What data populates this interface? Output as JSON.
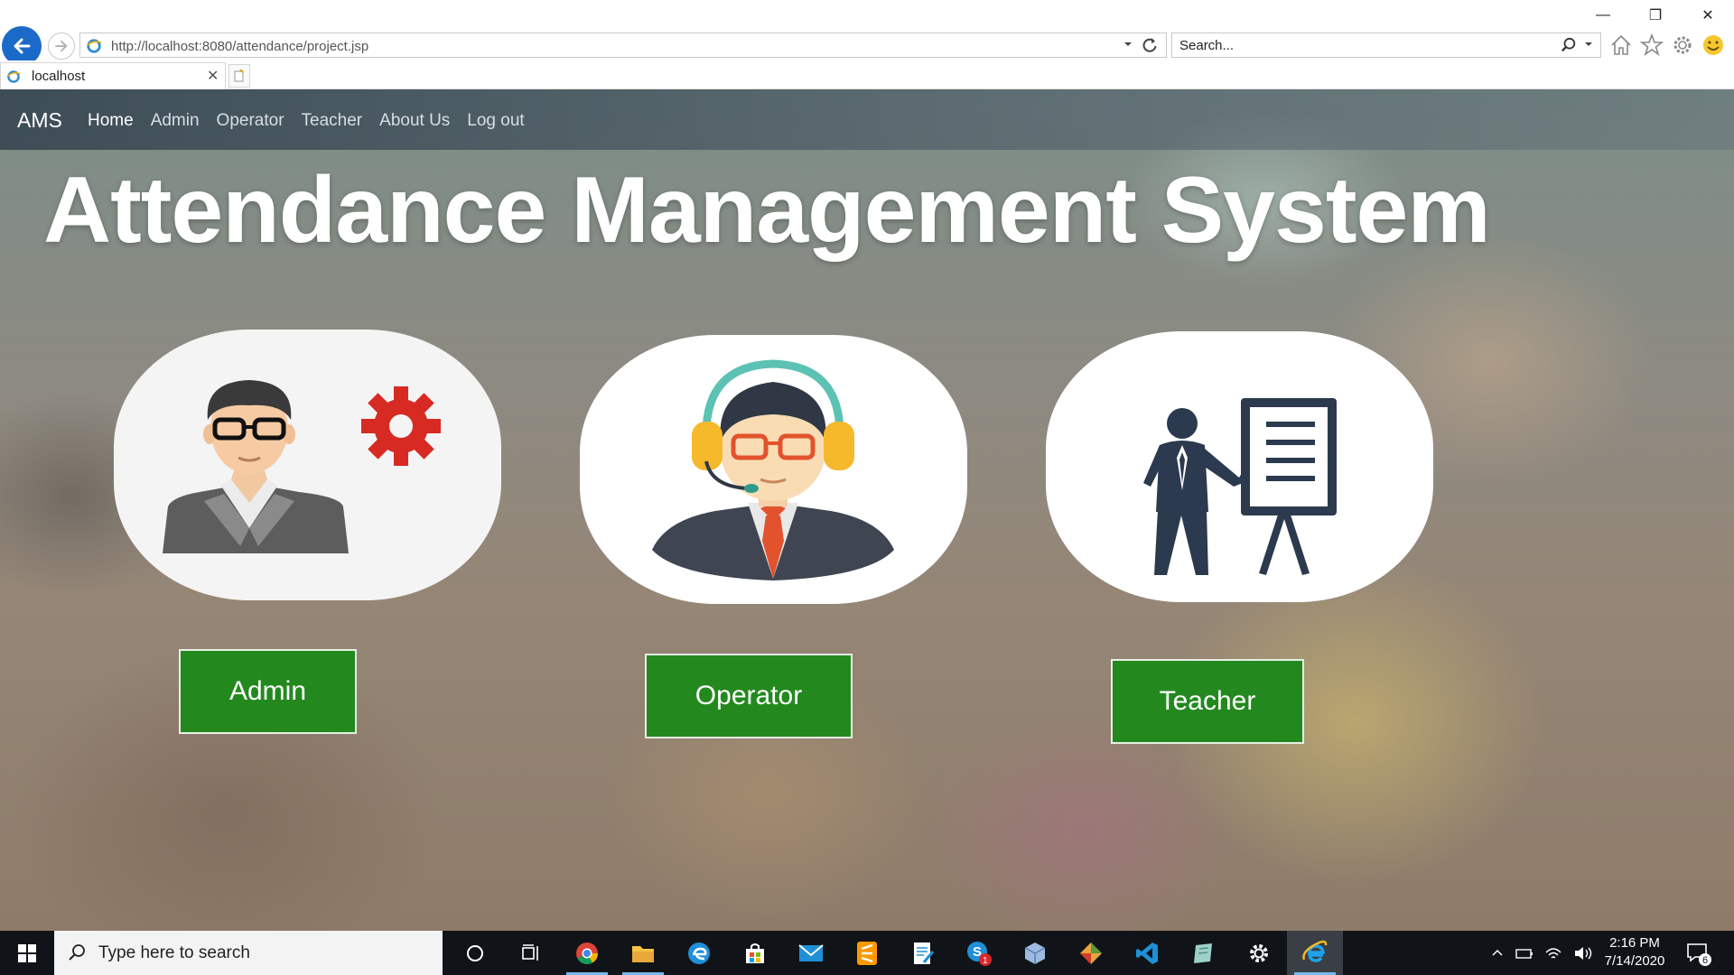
{
  "browser": {
    "url": "http://localhost:8080/attendance/project.jsp",
    "search_placeholder": "Search...",
    "tab_title": "localhost",
    "window_controls": {
      "minimize": "—",
      "restore": "❐",
      "close": "✕"
    }
  },
  "navbar": {
    "brand": "AMS",
    "links": [
      "Home",
      "Admin",
      "Operator",
      "Teacher",
      "About Us",
      "Log out"
    ],
    "active": "Home"
  },
  "hero": {
    "title": "Attendance Management System"
  },
  "roles": [
    {
      "icon": "admin-gear-icon",
      "button_label": "Admin"
    },
    {
      "icon": "operator-headset-icon",
      "button_label": "Operator"
    },
    {
      "icon": "teacher-presentation-icon",
      "button_label": "Teacher"
    }
  ],
  "colors": {
    "button_green": "#23891f",
    "browser_blue": "#1b6ac9",
    "taskbar": "#101418"
  },
  "taskbar": {
    "search_placeholder": "Type here to search",
    "apps": [
      "cortana",
      "task-view",
      "chrome",
      "file-explorer",
      "edge",
      "store",
      "mail",
      "sublime",
      "notepad",
      "skype",
      "virtualbox",
      "git",
      "vscode",
      "app",
      "settings",
      "internet-explorer"
    ],
    "time": "2:16 PM",
    "date": "7/14/2020",
    "notification_count": "6",
    "skype_badge": "1"
  }
}
